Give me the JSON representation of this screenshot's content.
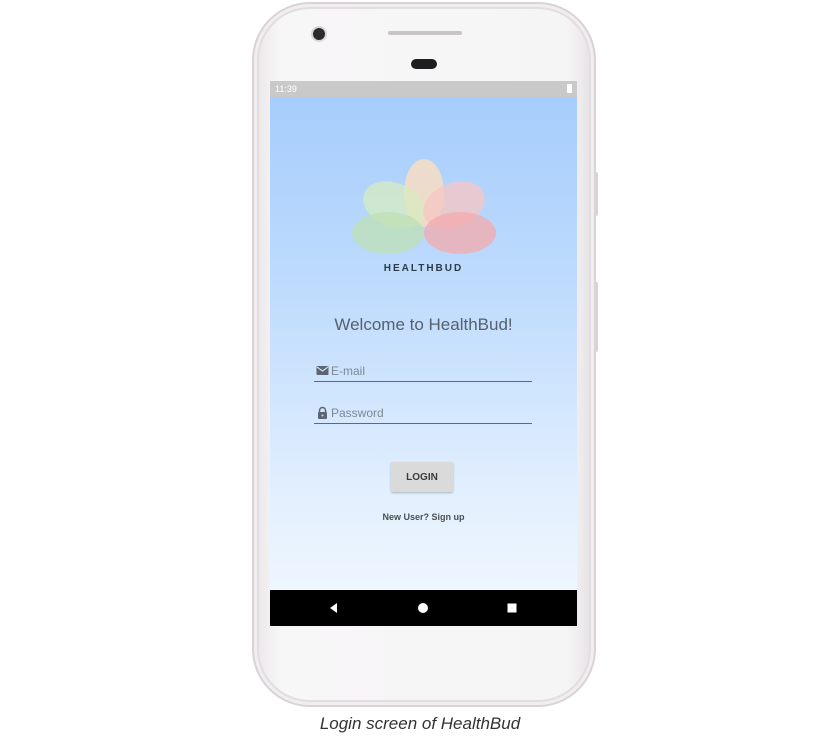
{
  "status_bar": {
    "time": "11:39"
  },
  "app": {
    "brand_name": "HEALTHBUD",
    "welcome_text": "Welcome to HealthBud!",
    "email_field": {
      "placeholder": "E-mail",
      "value": "",
      "icon": "mail-icon"
    },
    "password_field": {
      "placeholder": "Password",
      "value": "",
      "icon": "lock-icon"
    },
    "login_label": "LOGIN",
    "signup_link": "New User? Sign up"
  },
  "nav_bar": {
    "icons": [
      "back-triangle-icon",
      "home-circle-icon",
      "recents-square-icon"
    ]
  },
  "caption": "Login screen of HealthBud",
  "colors": {
    "gradient_top": "#a6cdfc",
    "gradient_bottom": "#eef6ff",
    "petal_green": "#c8e6b4",
    "petal_peach": "#f8ddc2",
    "petal_pink": "#f4a9ac"
  }
}
